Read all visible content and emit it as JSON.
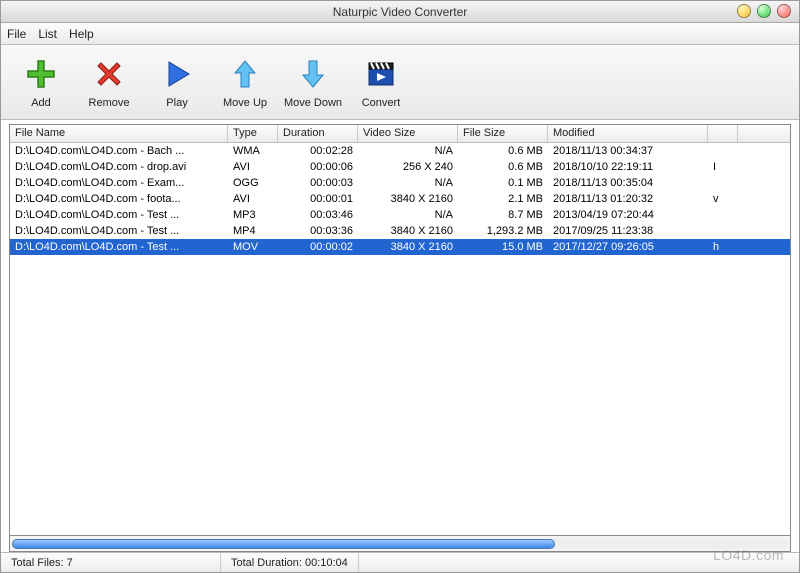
{
  "window": {
    "title": "Naturpic Video Converter"
  },
  "menu": {
    "file": "File",
    "list": "List",
    "help": "Help"
  },
  "toolbar": {
    "add": "Add",
    "remove": "Remove",
    "play": "Play",
    "move_up": "Move Up",
    "move_down": "Move Down",
    "convert": "Convert"
  },
  "columns": {
    "filename": "File Name",
    "type": "Type",
    "duration": "Duration",
    "video_size": "Video Size",
    "file_size": "File Size",
    "modified": "Modified"
  },
  "rows": [
    {
      "filename": "D:\\LO4D.com\\LO4D.com - Bach ...",
      "type": "WMA",
      "duration": "00:02:28",
      "video_size": "N/A",
      "file_size": "0.6 MB",
      "modified": "2018/11/13 00:34:37",
      "extra": "",
      "selected": false
    },
    {
      "filename": "D:\\LO4D.com\\LO4D.com - drop.avi",
      "type": "AVI",
      "duration": "00:00:06",
      "video_size": "256 X 240",
      "file_size": "0.6 MB",
      "modified": "2018/10/10 22:19:11",
      "extra": "I",
      "selected": false
    },
    {
      "filename": "D:\\LO4D.com\\LO4D.com - Exam...",
      "type": "OGG",
      "duration": "00:00:03",
      "video_size": "N/A",
      "file_size": "0.1 MB",
      "modified": "2018/11/13 00:35:04",
      "extra": "",
      "selected": false
    },
    {
      "filename": "D:\\LO4D.com\\LO4D.com - foota...",
      "type": "AVI",
      "duration": "00:00:01",
      "video_size": "3840 X 2160",
      "file_size": "2.1 MB",
      "modified": "2018/11/13 01:20:32",
      "extra": "v",
      "selected": false
    },
    {
      "filename": "D:\\LO4D.com\\LO4D.com - Test ...",
      "type": "MP3",
      "duration": "00:03:46",
      "video_size": "N/A",
      "file_size": "8.7 MB",
      "modified": "2013/04/19 07:20:44",
      "extra": "",
      "selected": false
    },
    {
      "filename": "D:\\LO4D.com\\LO4D.com - Test ...",
      "type": "MP4",
      "duration": "00:03:36",
      "video_size": "3840 X 2160",
      "file_size": "1,293.2 MB",
      "modified": "2017/09/25 11:23:38",
      "extra": "",
      "selected": false
    },
    {
      "filename": "D:\\LO4D.com\\LO4D.com - Test ...",
      "type": "MOV",
      "duration": "00:00:02",
      "video_size": "3840 X 2160",
      "file_size": "15.0 MB",
      "modified": "2017/12/27 09:26:05",
      "extra": "h",
      "selected": true
    }
  ],
  "status": {
    "total_files": "Total Files: 7",
    "total_duration": "Total Duration: 00:10:04"
  },
  "watermark": "LO4D.com"
}
